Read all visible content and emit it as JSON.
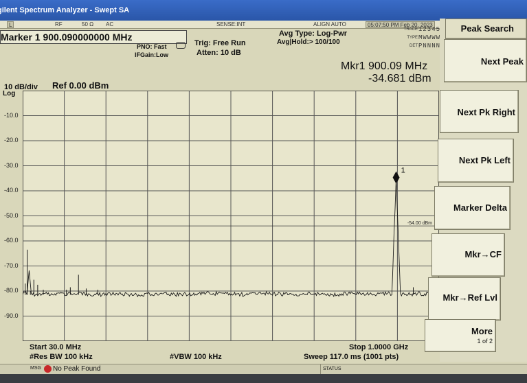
{
  "window": {
    "title": "gilent Spectrum Analyzer - Swept SA"
  },
  "status_row": {
    "cells": [
      "L",
      "RF",
      "50 Ω",
      "AC",
      "SENSE:INT",
      "ALIGN AUTO"
    ],
    "time": "05:07:50 PM Feb 20, 2023"
  },
  "trace_box": {
    "trace_label": "TRACE",
    "trace_value": "123456",
    "type_label": "TYPE",
    "type_value": "MWWWWW",
    "det_label": "DET",
    "det_value": "PNNNNN"
  },
  "header": {
    "marker_title": "Marker 1 900.090000000 MHz",
    "pno": "PNO: Fast",
    "ifgain": "IFGain:Low",
    "trig": "Trig: Free Run",
    "atten": "Atten: 10 dB",
    "avg_type": "Avg Type: Log-Pwr",
    "avg_hold": "Avg|Hold:> 100/100",
    "mkr_freq": "Mkr1 900.09 MHz",
    "mkr_ampl": "-34.681 dBm",
    "scale": "10 dB/div",
    "ref": "Ref 0.00 dBm",
    "log": "Log"
  },
  "chart_data": {
    "type": "line",
    "title": "",
    "xlabel": "",
    "ylabel": "",
    "xlim": [
      30.0,
      1000.0
    ],
    "ylim": [
      -100,
      0
    ],
    "yticks": [
      "-10.0",
      "-20.0",
      "-30.0",
      "-40.0",
      "-50.0",
      "-60.0",
      "-70.0",
      "-80.0",
      "-90.0"
    ],
    "noise_floor_dbm": -81.5,
    "display_line_dbm": -54.0,
    "display_line_label": "-54.00 dBm",
    "series": [
      {
        "x": [
          30.0,
          35.0,
          40.0,
          45.0,
          50.0,
          60.0,
          80.0,
          100.0,
          150.0,
          200.0,
          250.0,
          300.0,
          350.0,
          400.0,
          450.0,
          500.0,
          550.0,
          600.0,
          650.0,
          700.0,
          750.0,
          800.0,
          850.0,
          880.0,
          890.0,
          900.09,
          910.0,
          920.0,
          950.0,
          1000.0
        ],
        "y": [
          -81.5,
          -80.5,
          -81.5,
          -71.8,
          -81.0,
          -81.5,
          -81.0,
          -81.5,
          -81.0,
          -81.5,
          -81.0,
          -81.5,
          -81.0,
          -81.5,
          -81.0,
          -81.0,
          -81.5,
          -81.0,
          -81.5,
          -81.0,
          -81.5,
          -81.0,
          -81.5,
          -81.0,
          -81.5,
          -34.681,
          -81.0,
          -81.5,
          -81.0,
          -81.5
        ]
      }
    ],
    "spurs": [
      {
        "x": 36.0,
        "y": -77.0
      },
      {
        "x": 40.5,
        "y": -63.5
      },
      {
        "x": 48.0,
        "y": -80.0
      },
      {
        "x": 56.0,
        "y": -75.5
      },
      {
        "x": 65.0,
        "y": -77.5
      },
      {
        "x": 78.0,
        "y": -79.5
      },
      {
        "x": 132.0,
        "y": -79.5
      },
      {
        "x": 141.0,
        "y": -78.5
      },
      {
        "x": 160.0,
        "y": -73.5
      },
      {
        "x": 178.0,
        "y": -79.0
      },
      {
        "x": 205.0,
        "y": -79.5
      },
      {
        "x": 940.0,
        "y": -78.5
      }
    ],
    "marker": {
      "label": "1",
      "x": 900.09,
      "y": -34.681
    }
  },
  "bottom": {
    "start": "Start 30.0 MHz",
    "res_bw": "#Res BW 100 kHz",
    "vbw": "#VBW 100 kHz",
    "stop": "Stop 1.0000 GHz",
    "sweep": "Sweep 117.0 ms (1001 pts)"
  },
  "message": {
    "msg_label": "MSG",
    "text": "No Peak Found",
    "status_label": "STATUS"
  },
  "softkeys": {
    "title": "Peak Search",
    "items": [
      "Next Peak",
      "Next Pk Right",
      "Next Pk Left",
      "Marker Delta",
      "Mkr→CF",
      "Mkr→Ref Lvl",
      "More"
    ],
    "more_sub": "1 of 2"
  }
}
